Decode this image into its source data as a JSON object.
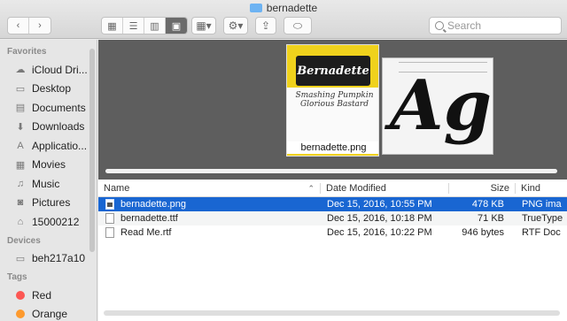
{
  "window": {
    "title": "bernadette"
  },
  "toolbar": {
    "search_placeholder": "Search",
    "view_modes": [
      "icon",
      "list",
      "column",
      "coverflow"
    ],
    "active_view": "coverflow"
  },
  "sidebar": {
    "favorites_header": "Favorites",
    "favorites": [
      {
        "label": "iCloud Dri...",
        "icon": "cloud-icon"
      },
      {
        "label": "Desktop",
        "icon": "desktop-icon"
      },
      {
        "label": "Documents",
        "icon": "document-icon"
      },
      {
        "label": "Downloads",
        "icon": "download-icon"
      },
      {
        "label": "Applicatio...",
        "icon": "applications-icon"
      },
      {
        "label": "Movies",
        "icon": "film-icon"
      },
      {
        "label": "Music",
        "icon": "music-icon"
      },
      {
        "label": "Pictures",
        "icon": "camera-icon"
      },
      {
        "label": "15000212",
        "icon": "home-icon"
      }
    ],
    "devices_header": "Devices",
    "devices": [
      {
        "label": "beh217a10",
        "icon": "computer-icon"
      }
    ],
    "tags_header": "Tags",
    "tags": [
      {
        "label": "Red",
        "color": "#fc5753"
      },
      {
        "label": "Orange",
        "color": "#fd9a2e"
      }
    ]
  },
  "coverflow": {
    "main_caption": "bernadette.png",
    "main_title_art": "Bernadette",
    "main_script_art": "Smashing Pumpkin Glorious Bastard",
    "side_glyph": "Ag"
  },
  "list": {
    "columns": {
      "name": "Name",
      "date": "Date Modified",
      "size": "Size",
      "kind": "Kind"
    },
    "rows": [
      {
        "name": "bernadette.png",
        "date": "Dec 15, 2016, 10:55 PM",
        "size": "478 KB",
        "kind": "PNG ima",
        "selected": true
      },
      {
        "name": "bernadette.ttf",
        "date": "Dec 15, 2016, 10:18 PM",
        "size": "71 KB",
        "kind": "TrueType",
        "selected": false
      },
      {
        "name": "Read Me.rtf",
        "date": "Dec 15, 2016, 10:22 PM",
        "size": "946 bytes",
        "kind": "RTF Doc",
        "selected": false
      }
    ]
  }
}
